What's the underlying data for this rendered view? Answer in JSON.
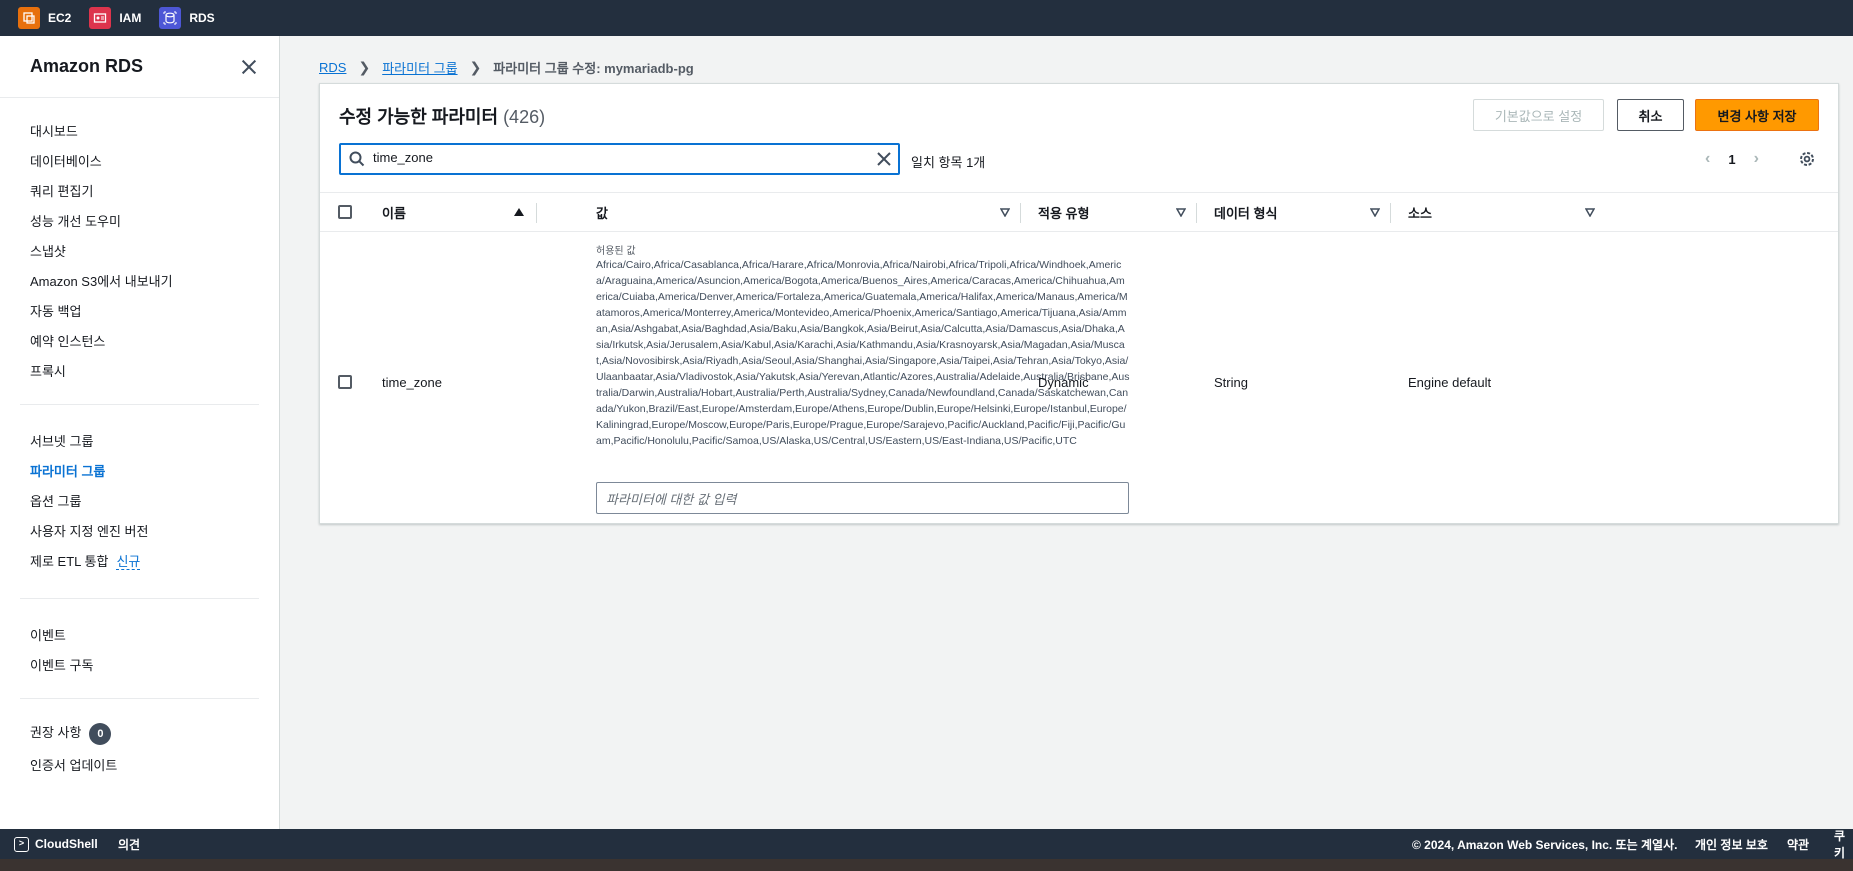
{
  "topbar": {
    "services": [
      {
        "label": "EC2",
        "color": "#e7700d",
        "icon": "ec2-icon"
      },
      {
        "label": "IAM",
        "color": "#dd344c",
        "icon": "iam-icon"
      },
      {
        "label": "RDS",
        "color": "#4d57d6",
        "icon": "rds-icon"
      }
    ]
  },
  "sidebar": {
    "title": "Amazon RDS",
    "items": [
      {
        "label": "대시보드"
      },
      {
        "label": "데이터베이스"
      },
      {
        "label": "쿼리 편집기"
      },
      {
        "label": "성능 개선 도우미"
      },
      {
        "label": "스냅샷"
      },
      {
        "label": "Amazon S3에서 내보내기"
      },
      {
        "label": "자동 백업"
      },
      {
        "label": "예약 인스턴스"
      },
      {
        "label": "프록시"
      },
      {
        "label": "서브넷 그룹"
      },
      {
        "label": "파라미터 그룹"
      },
      {
        "label": "옵션 그룹"
      },
      {
        "label": "사용자 지정 엔진 버전"
      },
      {
        "label": "제로 ETL 통합",
        "badge": "신규"
      },
      {
        "label": "이벤트"
      },
      {
        "label": "이벤트 구독"
      },
      {
        "label": "권장 사항",
        "count": "0"
      },
      {
        "label": "인증서 업데이트"
      }
    ]
  },
  "breadcrumb": {
    "items": [
      "RDS",
      "파라미터 그룹",
      "파라미터 그룹 수정: mymariadb-pg"
    ]
  },
  "panel": {
    "title": "수정 가능한 파라미터",
    "count": "(426)",
    "buttons": {
      "reset": "기본값으로 설정",
      "cancel": "취소",
      "save": "변경 사항 저장"
    },
    "search": {
      "value": "time_zone"
    },
    "match_text": "일치 항목 1개",
    "page": "1"
  },
  "table": {
    "columns": [
      "이름",
      "값",
      "적용 유형",
      "데이터 형식",
      "소스"
    ],
    "rows": [
      {
        "name": "time_zone",
        "allowed_label": "허용된 값",
        "allowed_values": "Africa/Cairo,Africa/Casablanca,Africa/Harare,Africa/Monrovia,Africa/Nairobi,Africa/Tripoli,Africa/Windhoek,America/Araguaina,America/Asuncion,America/Bogota,America/Buenos_Aires,America/Caracas,America/Chihuahua,America/Cuiaba,America/Denver,America/Fortaleza,America/Guatemala,America/Halifax,America/Manaus,America/Matamoros,America/Monterrey,America/Montevideo,America/Phoenix,America/Santiago,America/Tijuana,Asia/Amman,Asia/Ashgabat,Asia/Baghdad,Asia/Baku,Asia/Bangkok,Asia/Beirut,Asia/Calcutta,Asia/Damascus,Asia/Dhaka,Asia/Irkutsk,Asia/Jerusalem,Asia/Kabul,Asia/Karachi,Asia/Kathmandu,Asia/Krasnoyarsk,Asia/Magadan,Asia/Muscat,Asia/Novosibirsk,Asia/Riyadh,Asia/Seoul,Asia/Shanghai,Asia/Singapore,Asia/Taipei,Asia/Tehran,Asia/Tokyo,Asia/Ulaanbaatar,Asia/Vladivostok,Asia/Yakutsk,Asia/Yerevan,Atlantic/Azores,Australia/Adelaide,Australia/Brisbane,Australia/Darwin,Australia/Hobart,Australia/Perth,Australia/Sydney,Canada/Newfoundland,Canada/Saskatchewan,Canada/Yukon,Brazil/East,Europe/Amsterdam,Europe/Athens,Europe/Dublin,Europe/Helsinki,Europe/Istanbul,Europe/Kaliningrad,Europe/Moscow,Europe/Paris,Europe/Prague,Europe/Sarajevo,Pacific/Auckland,Pacific/Fiji,Pacific/Guam,Pacific/Honolulu,Pacific/Samoa,US/Alaska,US/Central,US/Eastern,US/East-Indiana,US/Pacific,UTC",
        "value_placeholder": "파라미터에 대한 값 입력",
        "apply_type": "Dynamic",
        "data_type": "String",
        "source": "Engine default"
      }
    ]
  },
  "footer": {
    "cloudshell": "CloudShell",
    "feedback": "의견",
    "copyright": "© 2024, Amazon Web Services, Inc. 또는 계열사.",
    "privacy": "개인 정보 보호",
    "terms": "약관",
    "cookies": "쿠키"
  },
  "colors": {
    "accent": "#0972d3",
    "primary_button": "#ff9900",
    "topbar": "#232f3e"
  }
}
